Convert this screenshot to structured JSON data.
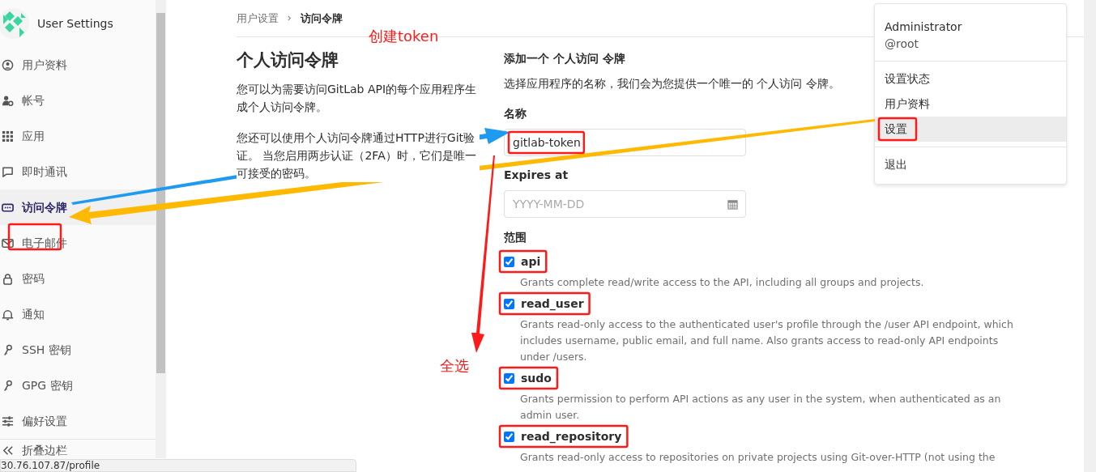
{
  "sidebar": {
    "title": "User Settings",
    "items": [
      {
        "label": "用户资料",
        "selected": false
      },
      {
        "label": "帐号",
        "selected": false
      },
      {
        "label": "应用",
        "selected": false
      },
      {
        "label": "即时通讯",
        "selected": false
      },
      {
        "label": "访问令牌",
        "selected": true
      },
      {
        "label": "电子邮件",
        "selected": false
      },
      {
        "label": "密码",
        "selected": false
      },
      {
        "label": "通知",
        "selected": false
      },
      {
        "label": "SSH 密钥",
        "selected": false
      },
      {
        "label": "GPG 密钥",
        "selected": false
      },
      {
        "label": "偏好设置",
        "selected": false
      }
    ],
    "collapse": "折叠边栏"
  },
  "breadcrumb": [
    "用户设置",
    "访问令牌"
  ],
  "intro": {
    "title": "个人访问令牌",
    "paragraphs": [
      "您可以为需要访问GitLab API的每个应用程序生成个人访问令牌。",
      "您还可以使用个人访问令牌通过HTTP进行Git验证。 当您启用两步认证（2FA）时，它们是唯一可接受的密码。"
    ]
  },
  "form": {
    "title": "添加一个 个人访问 令牌",
    "description": "选择应用程序的名称，我们会为您提供一个唯一的 个人访问 令牌。",
    "name_label": "名称",
    "name_value": "gitlab-token",
    "expires_label": "Expires at",
    "expires_placeholder": "YYYY-MM-DD",
    "scopes_label": "范围",
    "scopes": [
      {
        "name": "api",
        "checked": true,
        "description": "Grants complete read/write access to the API, including all groups and projects."
      },
      {
        "name": "read_user",
        "checked": true,
        "description": "Grants read-only access to the authenticated user's profile through the /user API endpoint, which includes username, public email, and full name. Also grants access to read-only API endpoints under /users."
      },
      {
        "name": "sudo",
        "checked": true,
        "description": "Grants permission to perform API actions as any user in the system, when authenticated as an admin user."
      },
      {
        "name": "read_repository",
        "checked": true,
        "description": "Grants read-only access to repositories on private projects using Git-over-HTTP (not using the"
      }
    ]
  },
  "user_menu": {
    "name": "Administrator",
    "username": "@root",
    "items": [
      {
        "label": "设置状态",
        "selected": false
      },
      {
        "label": "用户资料",
        "selected": false
      },
      {
        "label": "设置",
        "selected": true
      }
    ],
    "signout": "退出"
  },
  "annotations": [
    "创建token",
    "全选"
  ],
  "status_bar": "30.76.107.87/profile"
}
